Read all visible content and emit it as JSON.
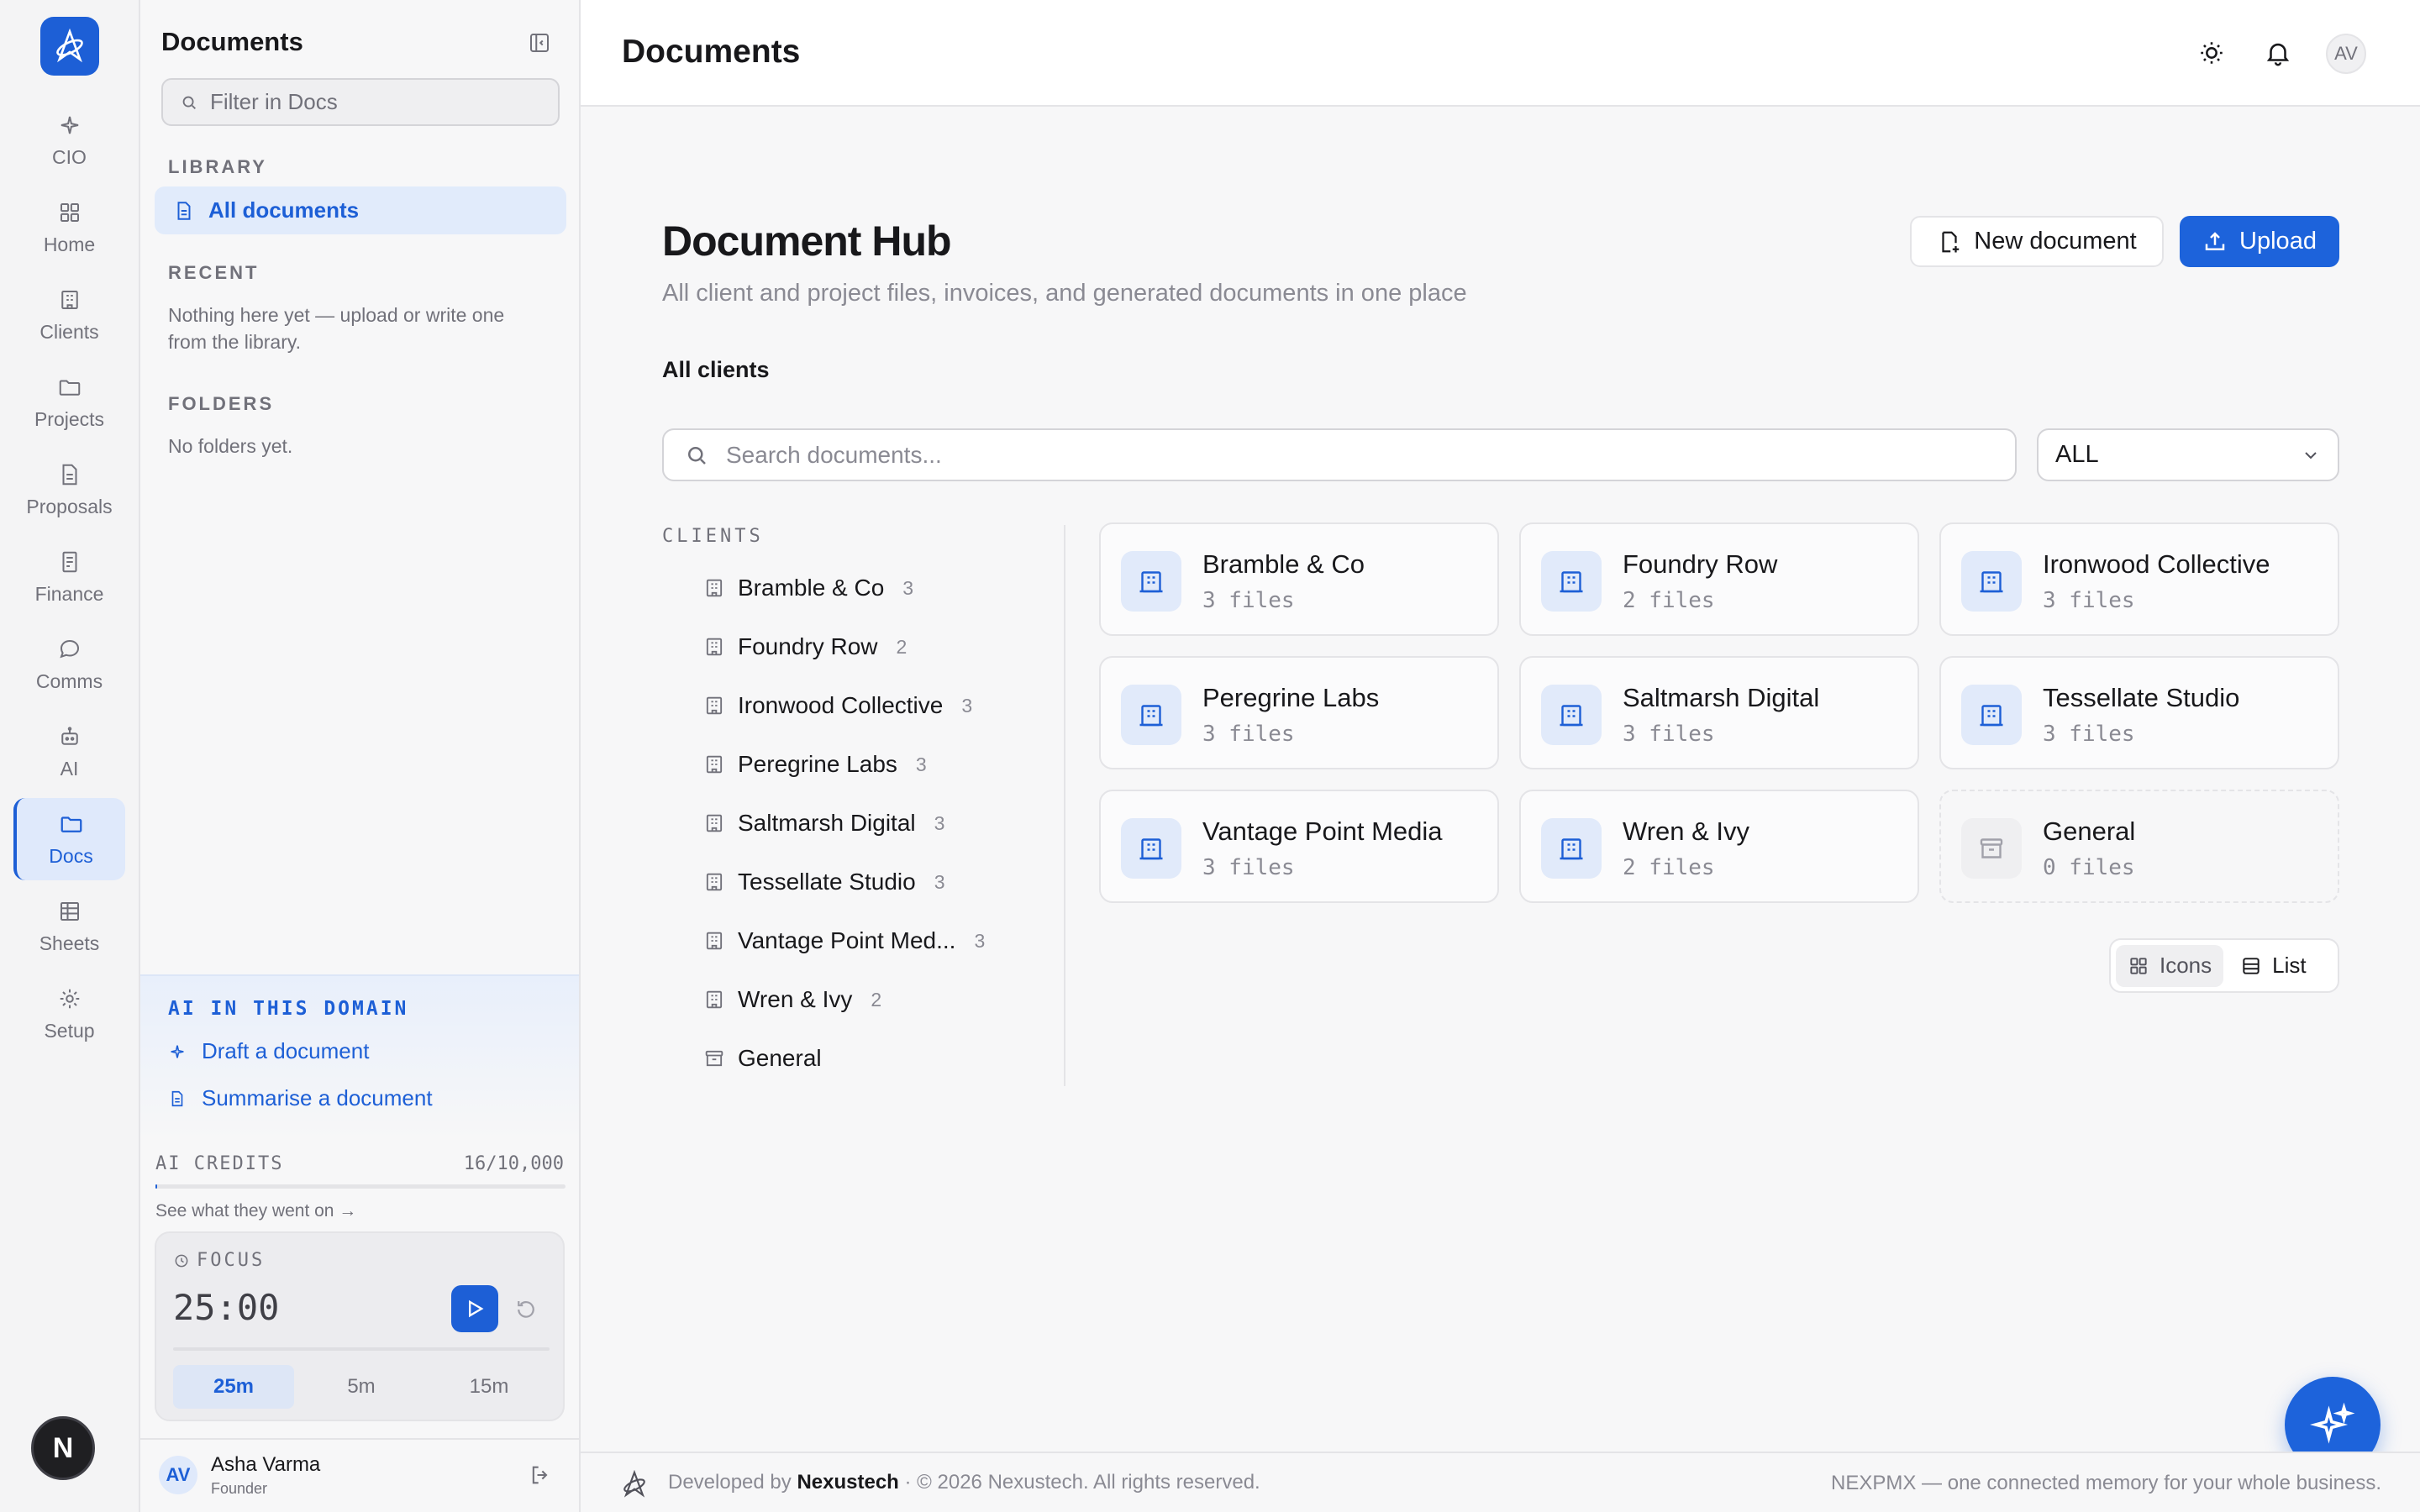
{
  "rail": {
    "items": [
      {
        "label": "CIO",
        "icon": "sparkle-icon"
      },
      {
        "label": "Home",
        "icon": "grid-icon"
      },
      {
        "label": "Clients",
        "icon": "building-icon"
      },
      {
        "label": "Projects",
        "icon": "folder-icon"
      },
      {
        "label": "Proposals",
        "icon": "file-icon"
      },
      {
        "label": "Finance",
        "icon": "receipt-icon"
      },
      {
        "label": "Comms",
        "icon": "chat-icon"
      },
      {
        "label": "AI",
        "icon": "robot-icon"
      },
      {
        "label": "Docs",
        "icon": "folder-icon"
      },
      {
        "label": "Sheets",
        "icon": "table-icon"
      },
      {
        "label": "Setup",
        "icon": "gear-icon"
      }
    ],
    "user_initial": "N"
  },
  "sidebar": {
    "title": "Documents",
    "filter_placeholder": "Filter in Docs",
    "library_label": "LIBRARY",
    "all_documents": "All documents",
    "recent_label": "RECENT",
    "recent_empty_1": "Nothing here yet — upload or write one",
    "recent_empty_2": "from the library.",
    "folders_label": "FOLDERS",
    "folders_empty": "No folders yet.",
    "ai_heading": "AI IN THIS DOMAIN",
    "ai_draft": "Draft a document",
    "ai_summarise": "Summarise a document",
    "credits_label": "AI CREDITS",
    "credits_value": "16/10,000",
    "credits_fraction": 0.0016,
    "credits_link": "See what they went on →",
    "focus_label": "FOCUS",
    "focus_time": "25:00",
    "focus_tabs": [
      "25m",
      "5m",
      "15m"
    ],
    "user_initials": "AV",
    "user_name": "Asha Varma",
    "user_role": "Founder"
  },
  "topbar": {
    "title": "Documents",
    "avatar": "AV"
  },
  "main": {
    "title": "Document Hub",
    "subtitle": "All client and project files, invoices, and generated documents in one place",
    "new_document": "New document",
    "upload": "Upload",
    "section": "All clients",
    "search_placeholder": "Search documents...",
    "filter_value": "ALL",
    "clients_label": "CLIENTS",
    "clients": [
      {
        "name": "Bramble & Co",
        "count": "3"
      },
      {
        "name": "Foundry Row",
        "count": "2"
      },
      {
        "name": "Ironwood Collective",
        "count": "3"
      },
      {
        "name": "Peregrine Labs",
        "count": "3"
      },
      {
        "name": "Saltmarsh Digital",
        "count": "3"
      },
      {
        "name": "Tessellate Studio",
        "count": "3"
      },
      {
        "name": "Vantage Point Med...",
        "count": "3"
      },
      {
        "name": "Wren & Ivy",
        "count": "2"
      },
      {
        "name": "General",
        "count": ""
      }
    ],
    "cards": [
      {
        "name": "Bramble & Co",
        "files": "3 files"
      },
      {
        "name": "Foundry Row",
        "files": "2 files"
      },
      {
        "name": "Ironwood Collective",
        "files": "3 files"
      },
      {
        "name": "Peregrine Labs",
        "files": "3 files"
      },
      {
        "name": "Saltmarsh Digital",
        "files": "3 files"
      },
      {
        "name": "Tessellate Studio",
        "files": "3 files"
      },
      {
        "name": "Vantage Point Media",
        "files": "3 files"
      },
      {
        "name": "Wren & Ivy",
        "files": "2 files"
      },
      {
        "name": "General",
        "files": "0 files"
      }
    ],
    "view_icons": "Icons",
    "view_list": "List"
  },
  "footer": {
    "developed_by": "Developed by",
    "company": "Nexustech",
    "copyright": "· © 2026 Nexustech. All rights reserved.",
    "tagline": "NEXPMX — one connected memory for your whole business."
  },
  "colors": {
    "accent": "#1d63db",
    "accent_soft": "#e1ebfb"
  }
}
